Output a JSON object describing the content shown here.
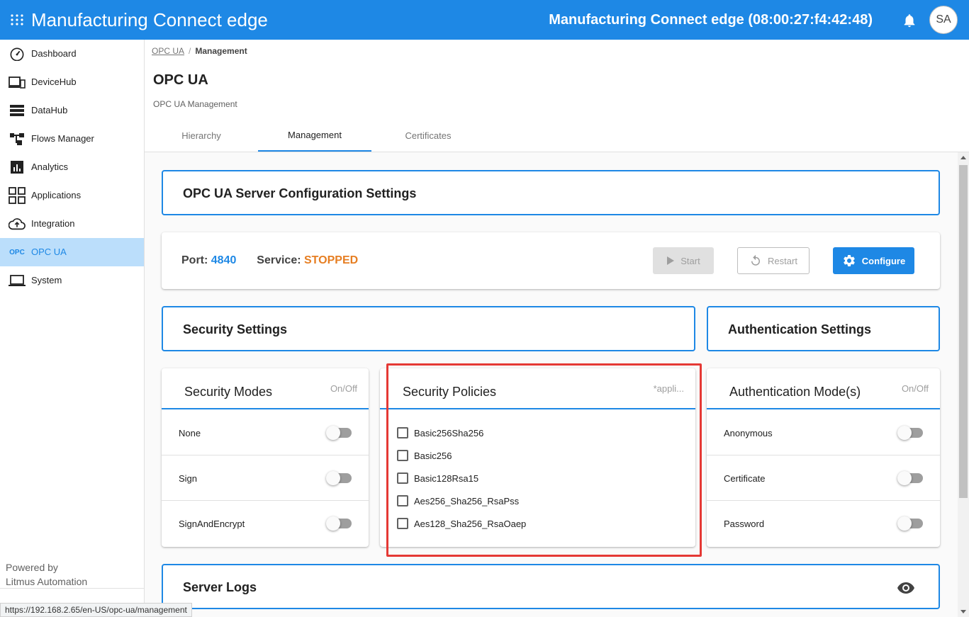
{
  "app": {
    "title": "Manufacturing Connect edge",
    "device_title": "Manufacturing Connect edge (08:00:27:f4:42:48)",
    "avatar_initials": "SA",
    "accent_color": "#1e88e5"
  },
  "sidebar": {
    "items": [
      {
        "label": "Dashboard",
        "icon": "speedometer-icon"
      },
      {
        "label": "DeviceHub",
        "icon": "devices-icon"
      },
      {
        "label": "DataHub",
        "icon": "server-stack-icon"
      },
      {
        "label": "Flows Manager",
        "icon": "flow-icon"
      },
      {
        "label": "Analytics",
        "icon": "analytics-icon"
      },
      {
        "label": "Applications",
        "icon": "apps-grid-icon"
      },
      {
        "label": "Integration",
        "icon": "cloud-upload-icon"
      },
      {
        "label": "OPC UA",
        "icon": "opc-icon",
        "tag": "OPC",
        "active": true
      },
      {
        "label": "System",
        "icon": "laptop-icon"
      }
    ],
    "powered_line1": "Powered by",
    "powered_line2": "Litmus Automation"
  },
  "status_url": "https://192.168.2.65/en-US/opc-ua/management",
  "breadcrumb": {
    "parent": "OPC UA",
    "separator": "/",
    "current": "Management"
  },
  "page": {
    "title": "OPC UA",
    "subtitle": "OPC UA Management"
  },
  "tabs": [
    {
      "label": "Hierarchy"
    },
    {
      "label": "Management",
      "active": true
    },
    {
      "label": "Certificates"
    }
  ],
  "server_config": {
    "title": "OPC UA Server Configuration Settings",
    "port_label": "Port:",
    "port_value": "4840",
    "service_label": "Service:",
    "service_value": "STOPPED",
    "service_color": "#e67e22",
    "start_label": "Start",
    "restart_label": "Restart",
    "configure_label": "Configure"
  },
  "security_settings": {
    "title": "Security Settings"
  },
  "authentication_settings": {
    "title": "Authentication Settings"
  },
  "security_modes": {
    "title": "Security Modes",
    "note": "On/Off",
    "items": [
      {
        "label": "None"
      },
      {
        "label": "Sign"
      },
      {
        "label": "SignAndEncrypt"
      }
    ]
  },
  "security_policies": {
    "title": "Security Policies",
    "note": "*appli...",
    "items": [
      {
        "label": "Basic256Sha256"
      },
      {
        "label": "Basic256"
      },
      {
        "label": "Basic128Rsa15"
      },
      {
        "label": "Aes256_Sha256_RsaPss"
      },
      {
        "label": "Aes128_Sha256_RsaOaep"
      }
    ]
  },
  "auth_modes": {
    "title": "Authentication Mode(s)",
    "note": "On/Off",
    "items": [
      {
        "label": "Anonymous"
      },
      {
        "label": "Certificate"
      },
      {
        "label": "Password"
      }
    ]
  },
  "server_logs": {
    "title": "Server Logs"
  }
}
